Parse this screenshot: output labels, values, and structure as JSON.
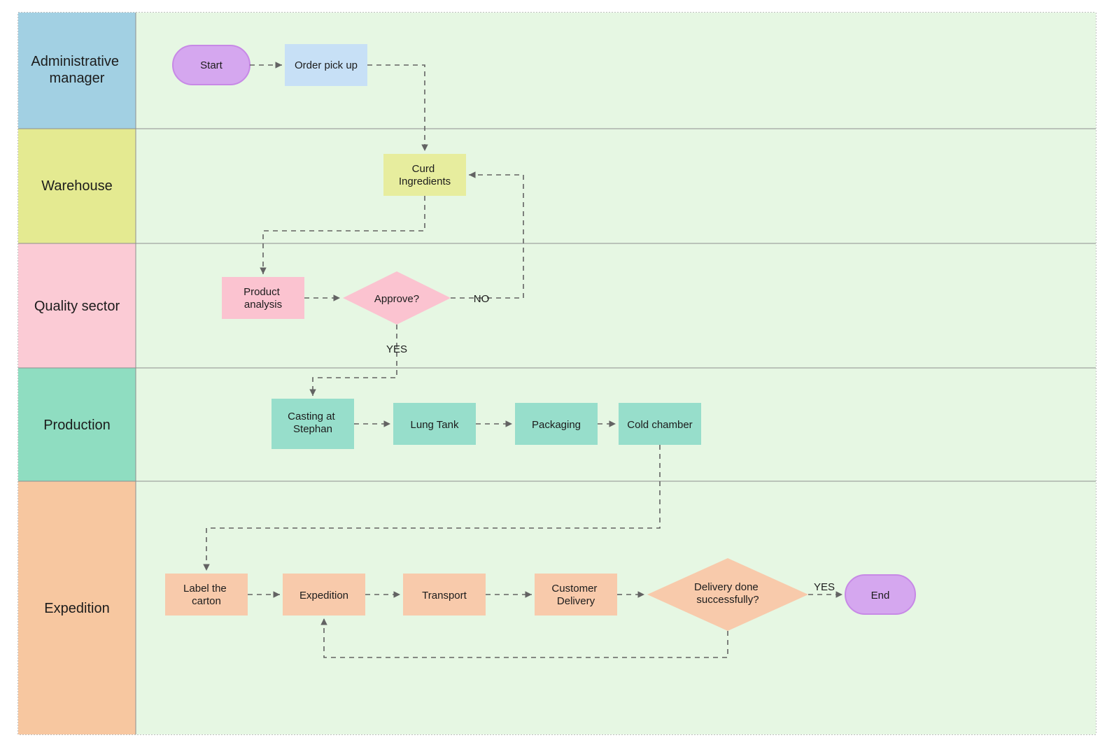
{
  "lanes": {
    "admin": "Administrative manager",
    "warehouse": "Warehouse",
    "quality": "Quality sector",
    "production": "Production",
    "expedition": "Expedition"
  },
  "nodes": {
    "start": "Start",
    "order_pickup": "Order pick up",
    "curd": "Curd Ingredients",
    "analysis": "Product analysis",
    "approve": "Approve?",
    "casting": "Casting at Stephan",
    "lung_tank": "Lung Tank",
    "packaging": "Packaging",
    "cold_chamber": "Cold chamber",
    "label_carton": "Label the carton",
    "expedition": "Expedition",
    "transport": "Transport",
    "customer_del": "Customer Delivery",
    "delivery_done": "Delivery done successfully?",
    "end": "End"
  },
  "labels": {
    "no": "NO",
    "yes": "YES",
    "yes2": "YES"
  },
  "colors": {
    "lane_admin": "#a2d0e3",
    "lane_warehouse": "#e4ea91",
    "lane_quality": "#fbcbd5",
    "lane_production": "#8fddc1",
    "lane_expedition": "#f7c7a0",
    "body_bg": "#e6f7e3",
    "start_end": "#d5a7ef",
    "start_end_border": "#c789e6",
    "node_admin": "#c7e0f6",
    "node_warehouse": "#e7ed9e",
    "node_quality": "#fbc3d0",
    "node_prod": "#97decb",
    "node_exp": "#f8caab",
    "grid": "#b7b7b7",
    "dotted_border": "#999999",
    "arrow": "#636363"
  }
}
